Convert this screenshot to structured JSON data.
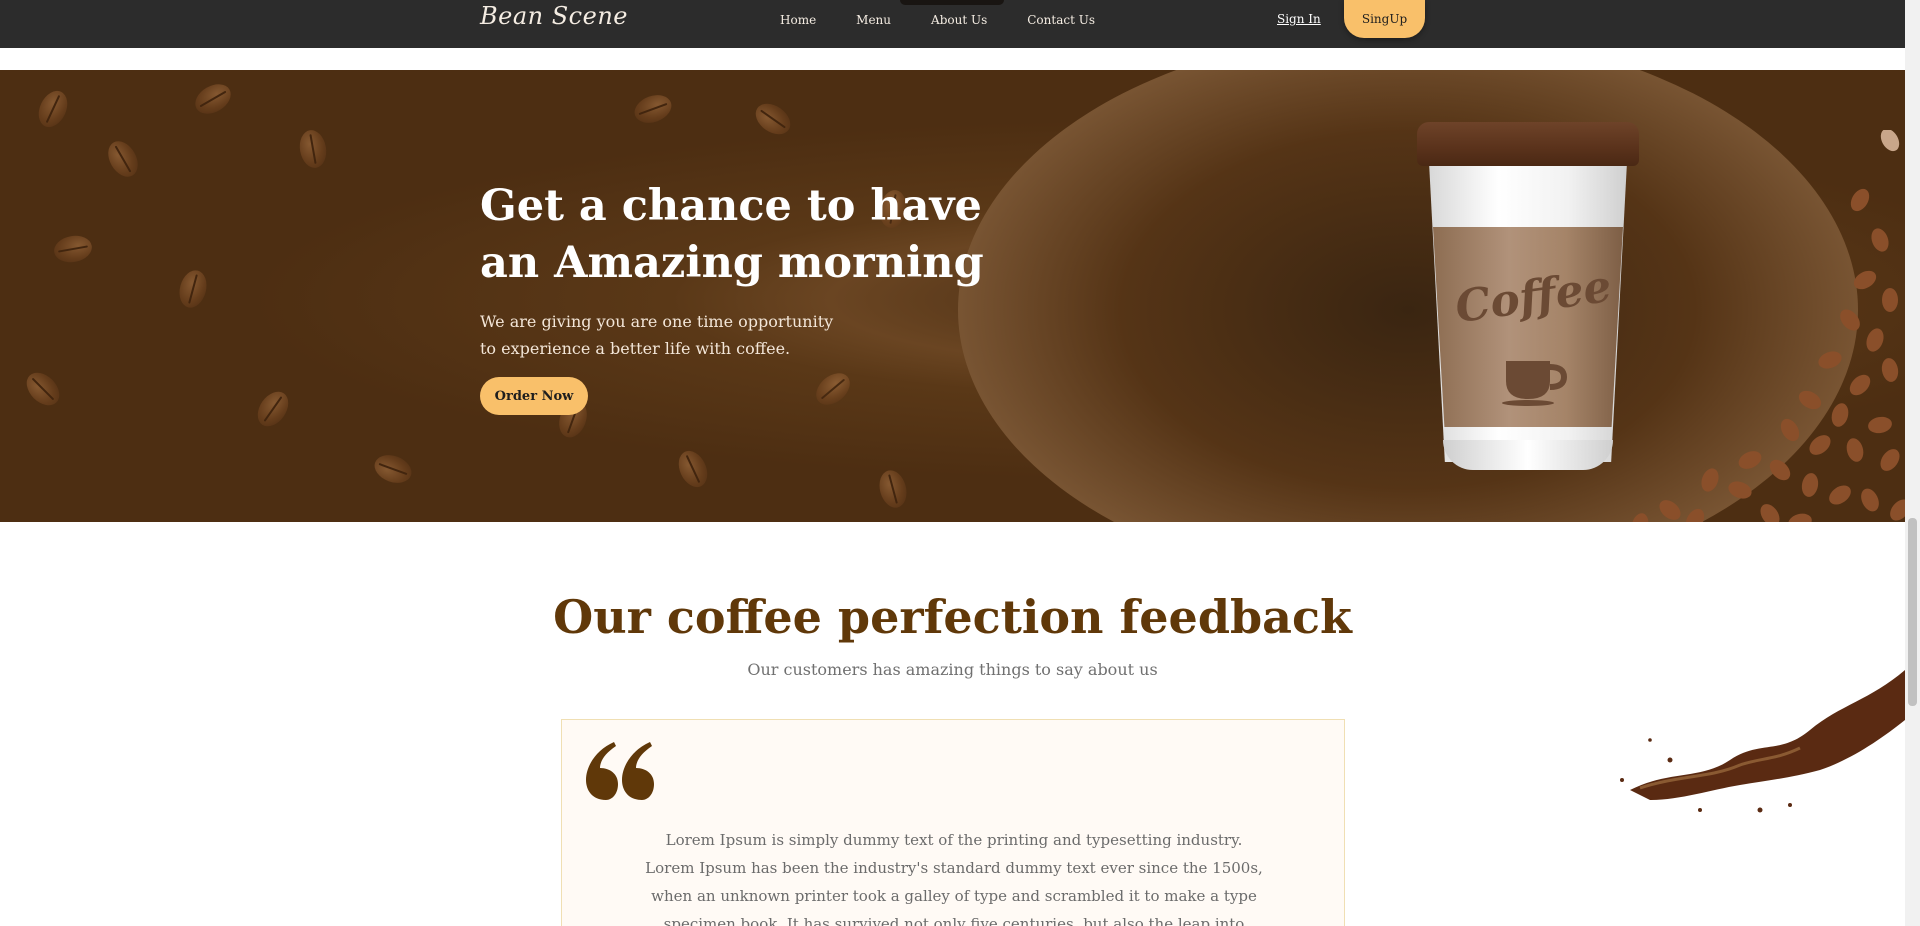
{
  "nav": {
    "logo": "Bean Scene",
    "links": [
      "Home",
      "Menu",
      "About Us",
      "Contact Us"
    ],
    "sign_in": "Sign In",
    "signup": "SingUp"
  },
  "hero": {
    "title": "Get a chance to have an Amazing morning",
    "subtitle": "We are giving you are one time opportunity to experience a better life with coffee.",
    "order_button": "Order Now",
    "cup_word": "Coffee"
  },
  "feedback": {
    "title": "Our coffee perfection feedback",
    "subtitle": "Our customers has amazing things to say about us",
    "quote": "Lorem Ipsum is simply dummy text of the printing and typesetting industry. Lorem Ipsum has been the industry's standard dummy text ever since the 1500s, when an unknown printer took a galley of type and scrambled it to make a type specimen book. It has survived not only five centuries, but also the leap into electronic typesetting, remaining essentially unchanged. It was"
  },
  "colors": {
    "accent": "#f9c06a",
    "brand_brown": "#603809",
    "nav_bg": "#2c2c2c"
  },
  "icons": [
    "quote-icon",
    "coffee-mug-icon"
  ]
}
